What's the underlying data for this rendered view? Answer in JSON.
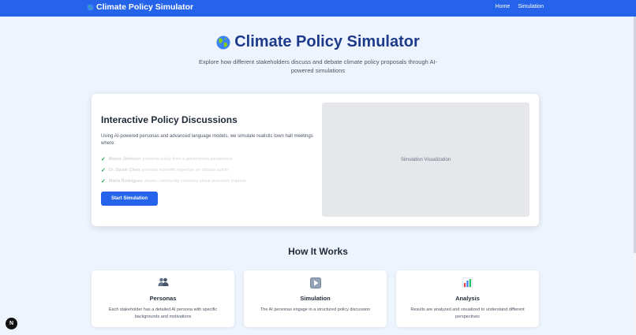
{
  "nav": {
    "brand": "Climate Policy Simulator",
    "links": [
      "Home",
      "Simulation"
    ]
  },
  "hero": {
    "title": "Climate Policy Simulator",
    "subtitle": "Explore how different stakeholders discuss and debate climate policy proposals through AI-powered simulations"
  },
  "intro": {
    "heading": "Interactive Policy Discussions",
    "description": "Using AI-powered personas and advanced language models, we simulate realistic town hall meetings where:",
    "points": [
      {
        "name": "Mayor Johnson",
        "text": "presents policy from a government perspective"
      },
      {
        "name": "Dr. Sarah Chen",
        "text": "provides scientific expertise on climate action"
      },
      {
        "name": "Maria Rodriguez",
        "text": "shares community concerns about economic impacts"
      }
    ],
    "button": "Start Simulation",
    "visualization": "Simulation Visualization"
  },
  "how": {
    "title": "How It Works",
    "features": [
      {
        "icon": "people-icon",
        "title": "Personas",
        "text": "Each stakeholder has a detailed AI persona with specific backgrounds and motivations"
      },
      {
        "icon": "play-icon",
        "title": "Simulation",
        "text": "The AI personas engage in a structured policy discussion"
      },
      {
        "icon": "bar-chart-icon",
        "title": "Analysis",
        "text": "Results are analyzed and visualized to understand different perspectives"
      }
    ]
  },
  "colors": {
    "primary": "#2563eb",
    "heading": "#1e3a8a",
    "background": "#eef4fd"
  }
}
